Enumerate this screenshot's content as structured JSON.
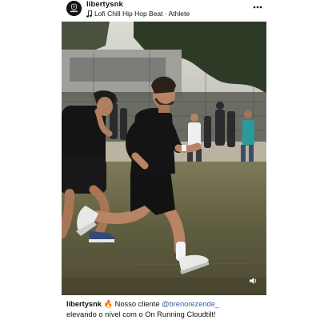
{
  "post": {
    "username": "libertysnk",
    "audio": "Lofi Chill Hip Hop Beat · Athlete",
    "avatar_text": "LIBERTY"
  },
  "icons": {
    "music": "music-note-icon",
    "more": "more-horizontal-icon",
    "sound": "speaker-icon",
    "fire": "fire-emoji"
  },
  "caption": {
    "username": "libertysnk",
    "emoji": "🔥",
    "text_before_mention": " Nosso cliente ",
    "mention": "@brenorezende_",
    "text_after_mention": "elevando o nível com o On Running Cloudtilt!"
  },
  "colors": {
    "mention": "#3a5ea8",
    "text": "#111111"
  }
}
